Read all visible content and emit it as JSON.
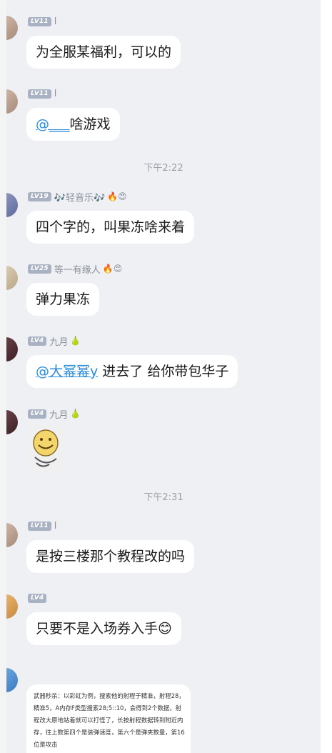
{
  "messages": [
    {
      "level": "LV11",
      "nick": "l",
      "text": "为全服某福利，可以的"
    },
    {
      "level": "LV11",
      "nick": "l",
      "mention": "@___",
      "text": "啥游戏"
    },
    {
      "level": "LV19",
      "nick": "🎶轻音乐🎶",
      "badges": "🔥😍",
      "text": "四个字的，叫果冻啥来着"
    },
    {
      "level": "LV25",
      "nick": "等一有缘人",
      "badges": "🔥😍",
      "text": "弹力果冻"
    },
    {
      "level": "LV4",
      "nick": "九月",
      "badges": "🍐",
      "mention": "@大幂幂y",
      "text": " 进去了 给你带包华子"
    },
    {
      "level": "LV4",
      "nick": "九月",
      "badges": "🍐",
      "sticker": "smiling-sticker"
    },
    {
      "level": "LV11",
      "nick": "l",
      "text": "是按三楼那个教程改的吗"
    },
    {
      "level": "LV4",
      "nick": "",
      "text": "只要不是入场券入手😊"
    }
  ],
  "times": [
    "下午2:22",
    "下午2:31"
  ],
  "doc_message": {
    "text": "武器秒杀：以彩虹为例，搜索他的射程于精准，射程28，精准5，A内存F类型搜索28;5::10，会得到2个数据，射程改大原地站着就可以打怪了，长按射程数据转到附近内存，往上数第四个是装弹速度，第六个是弹夹数量，第16位是攻击"
  }
}
